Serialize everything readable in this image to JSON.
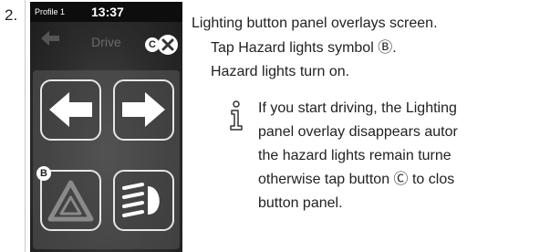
{
  "step": {
    "number": "2."
  },
  "screen": {
    "profile": "Profile 1",
    "time": "13:37",
    "title": "Drive",
    "close_callout": "C",
    "hazard_callout": "B"
  },
  "instructions": {
    "line1": "Lighting button panel overlays screen.",
    "line2": "Tap Hazard lights symbol Ⓑ.",
    "line3": "Hazard lights turn on."
  },
  "note": {
    "icon": "info-icon",
    "lines": [
      "If you start driving, the Lighting",
      "panel overlay disappears autor",
      "the hazard lights remain turne",
      "otherwise tap button Ⓒ to clos",
      "button panel."
    ]
  }
}
